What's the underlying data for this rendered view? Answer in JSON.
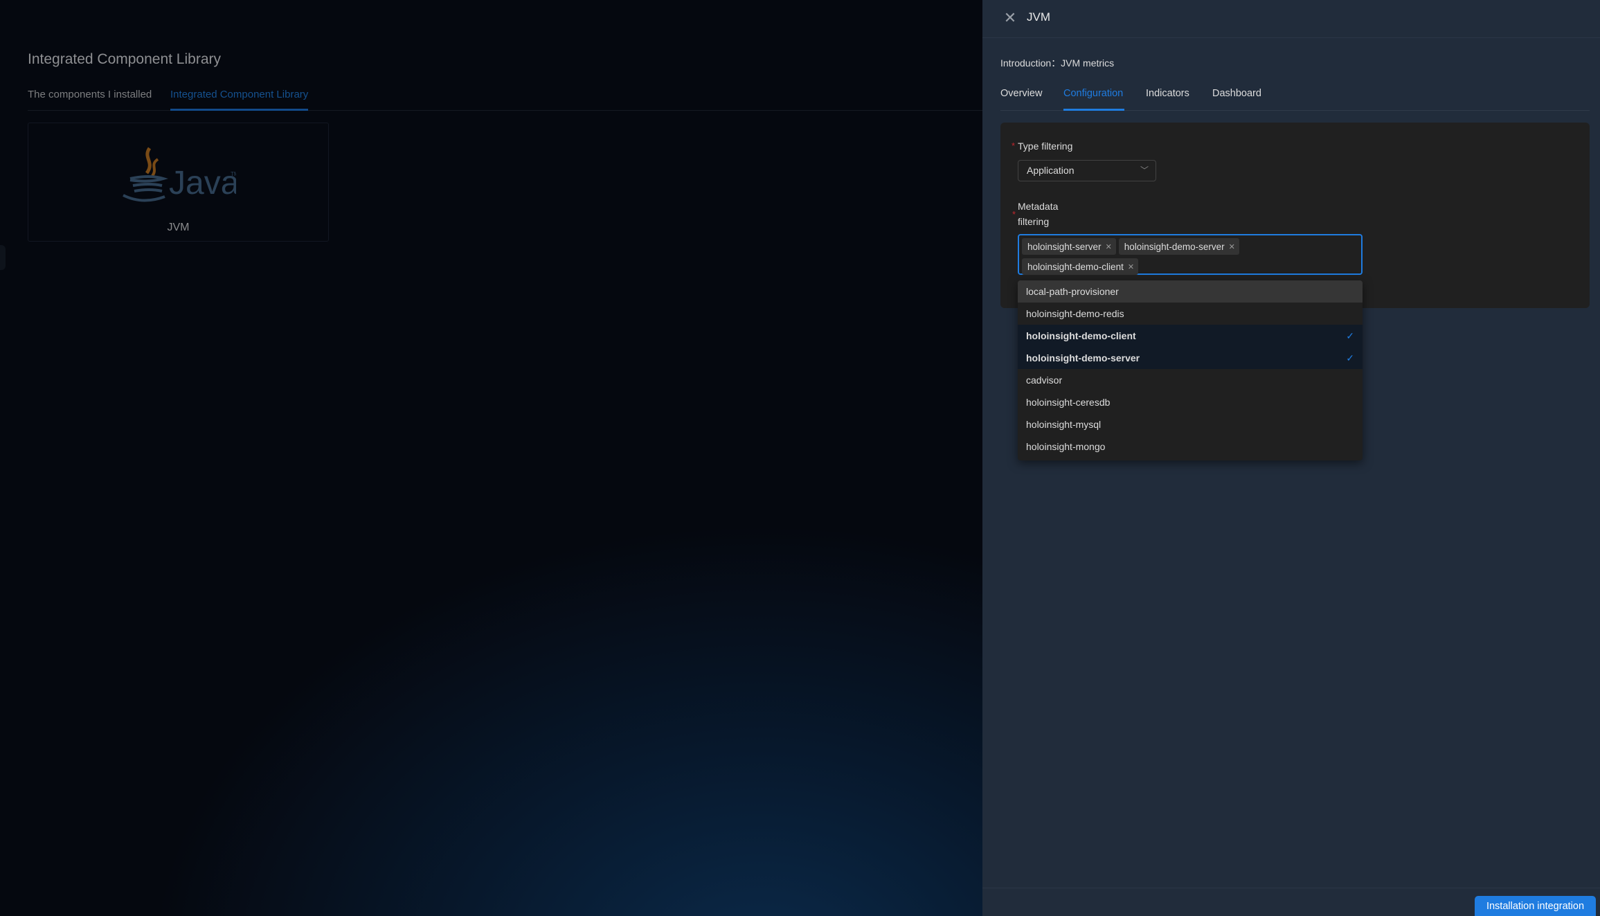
{
  "page": {
    "title": "Integrated Component Library",
    "tabs": [
      {
        "label": "The components I installed"
      },
      {
        "label": "Integrated Component Library",
        "active": true
      }
    ],
    "cards": [
      {
        "label": "JVM",
        "logo": "java-logo"
      }
    ]
  },
  "drawer": {
    "title": "JVM",
    "close_icon": "close-icon",
    "intro_label": "Introduction：",
    "intro_value": "JVM metrics",
    "tabs": [
      {
        "label": "Overview"
      },
      {
        "label": "Configuration",
        "active": true
      },
      {
        "label": "Indicators"
      },
      {
        "label": "Dashboard"
      }
    ],
    "form": {
      "required_mark": "*",
      "type_label": "Type filtering",
      "type_value": "Application",
      "meta_label_1": "Metadata",
      "meta_label_2": "filtering",
      "selected_tags": [
        "holoinsight-server",
        "holoinsight-demo-server",
        "holoinsight-demo-client"
      ],
      "options": [
        {
          "label": "local-path-provisioner",
          "selected": false
        },
        {
          "label": "holoinsight-demo-redis",
          "selected": false
        },
        {
          "label": "holoinsight-demo-client",
          "selected": true
        },
        {
          "label": "holoinsight-demo-server",
          "selected": true
        },
        {
          "label": "cadvisor",
          "selected": false
        },
        {
          "label": "holoinsight-ceresdb",
          "selected": false
        },
        {
          "label": "holoinsight-mysql",
          "selected": false
        },
        {
          "label": "holoinsight-mongo",
          "selected": false
        }
      ]
    },
    "install_button": "Installation integration"
  },
  "colors": {
    "accent": "#1f7ce0",
    "drawer_bg": "#212c3b",
    "panel_bg": "#202020",
    "required": "#c0272d"
  }
}
